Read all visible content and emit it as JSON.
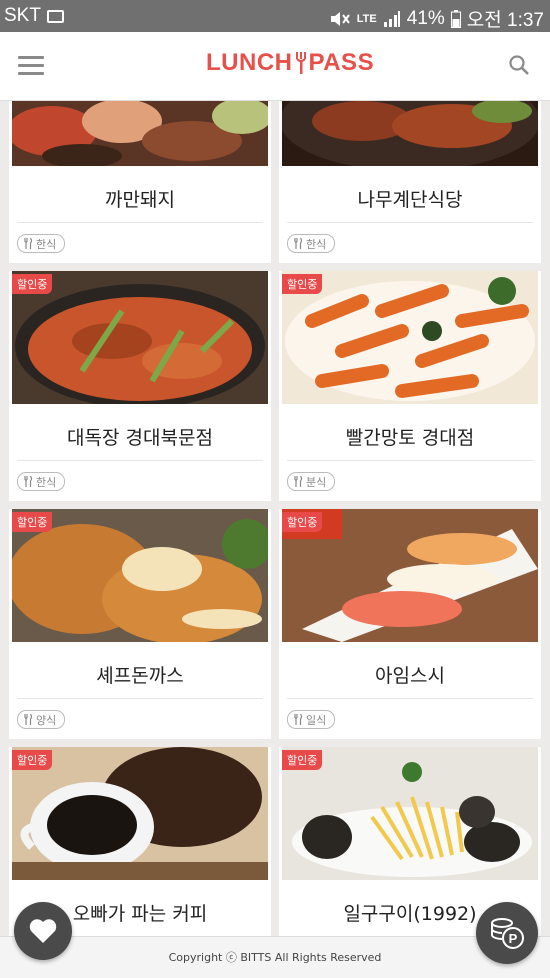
{
  "status_bar": {
    "carrier": "SKT",
    "lte_label": "LTE",
    "battery": "41%",
    "time": "오전 1:37"
  },
  "app": {
    "logo_left": "LUNCH",
    "logo_right": "PASS",
    "accent_color": "#e8504a"
  },
  "restaurants": [
    {
      "name": "까만돼지",
      "category": "한식",
      "badge": ""
    },
    {
      "name": "나무계단식당",
      "category": "한식",
      "badge": ""
    },
    {
      "name": "대독장 경대북문점",
      "category": "한식",
      "badge": "할인중"
    },
    {
      "name": "빨간망토 경대점",
      "category": "분식",
      "badge": "할인중"
    },
    {
      "name": "셰프돈까스",
      "category": "양식",
      "badge": "할인중"
    },
    {
      "name": "아임스시",
      "category": "일식",
      "badge": "할인중"
    },
    {
      "name": "오빠가 파는 커피",
      "category": "",
      "badge": "할인중"
    },
    {
      "name": "일구구이(1992)",
      "category": "",
      "badge": "할인중"
    }
  ],
  "footer": {
    "copyright": "Copyright ⓒ BITTS All Rights Reserved"
  },
  "icons": {
    "heart": "heart-icon",
    "coin": "coin-icon",
    "menu": "hamburger-menu-icon",
    "search": "search-icon",
    "tag": "fork-spoon-icon"
  }
}
